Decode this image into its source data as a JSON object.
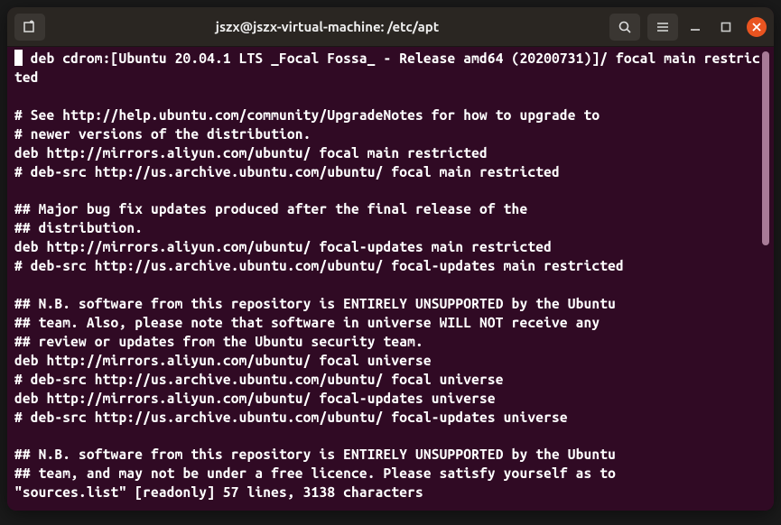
{
  "titlebar": {
    "title": "jszx@jszx-virtual-machine: /etc/apt"
  },
  "terminal": {
    "lines": [
      "# deb cdrom:[Ubuntu 20.04.1 LTS _Focal Fossa_ - Release amd64 (20200731)]/ focal main restricted",
      "",
      "# See http://help.ubuntu.com/community/UpgradeNotes for how to upgrade to",
      "# newer versions of the distribution.",
      "deb http://mirrors.aliyun.com/ubuntu/ focal main restricted",
      "# deb-src http://us.archive.ubuntu.com/ubuntu/ focal main restricted",
      "",
      "## Major bug fix updates produced after the final release of the",
      "## distribution.",
      "deb http://mirrors.aliyun.com/ubuntu/ focal-updates main restricted",
      "# deb-src http://us.archive.ubuntu.com/ubuntu/ focal-updates main restricted",
      "",
      "## N.B. software from this repository is ENTIRELY UNSUPPORTED by the Ubuntu",
      "## team. Also, please note that software in universe WILL NOT receive any",
      "## review or updates from the Ubuntu security team.",
      "deb http://mirrors.aliyun.com/ubuntu/ focal universe",
      "# deb-src http://us.archive.ubuntu.com/ubuntu/ focal universe",
      "deb http://mirrors.aliyun.com/ubuntu/ focal-updates universe",
      "# deb-src http://us.archive.ubuntu.com/ubuntu/ focal-updates universe",
      "",
      "## N.B. software from this repository is ENTIRELY UNSUPPORTED by the Ubuntu",
      "## team, and may not be under a free licence. Please satisfy yourself as to"
    ],
    "status": "\"sources.list\" [readonly] 57 lines, 3138 characters"
  },
  "scroll": {
    "thumb_height": 215,
    "thumb_top": 0
  },
  "colors": {
    "terminal_bg": "#300a24",
    "text": "#ffffff",
    "accent_close": "#e95420",
    "titlebar_bg": "#2a2622"
  }
}
